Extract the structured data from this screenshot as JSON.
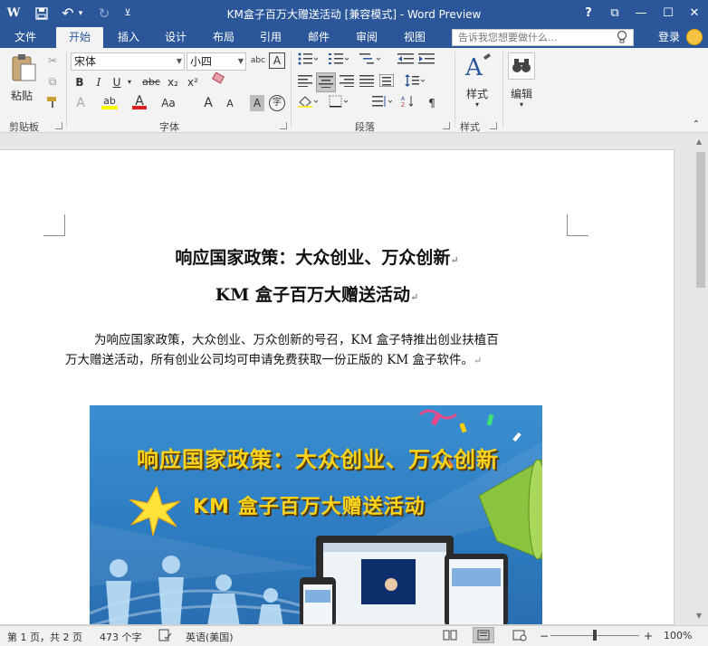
{
  "window": {
    "title": "KM盒子百万大赠送活动 [兼容模式] - Word Preview",
    "help": "?",
    "ribbon_display": "⧉",
    "minimize": "—",
    "maximize": "☐",
    "close": "✕"
  },
  "quick_access": {
    "app_logo": "W",
    "save": "💾",
    "undo": "↶",
    "undo_dd": "▾",
    "redo": "↻",
    "customize": "⊻"
  },
  "tabs": [
    {
      "label": "文件"
    },
    {
      "label": "开始"
    },
    {
      "label": "插入"
    },
    {
      "label": "设计"
    },
    {
      "label": "布局"
    },
    {
      "label": "引用"
    },
    {
      "label": "邮件"
    },
    {
      "label": "审阅"
    },
    {
      "label": "视图"
    }
  ],
  "tell_me": {
    "placeholder": "告诉我您想要做什么..."
  },
  "account": {
    "login": "登录"
  },
  "ribbon": {
    "clipboard": {
      "label": "剪贴板",
      "paste": "粘贴"
    },
    "font": {
      "label": "字体",
      "font_name": "宋体",
      "font_size": "小四",
      "bold": "B",
      "italic": "I",
      "underline": "U",
      "strike": "abc",
      "subscript": "x₂",
      "superscript": "x²",
      "effects": "A",
      "highlight": "ab",
      "font_color": "A",
      "case": "Aa",
      "grow": "A",
      "shrink": "A",
      "char_shading": "A",
      "enclose": "字",
      "phonetic": "abc",
      "char_border": "A"
    },
    "paragraph": {
      "label": "段落"
    },
    "styles": {
      "label": "样式",
      "styles_button": "样式"
    },
    "editing": {
      "editing_button": "编辑"
    }
  },
  "document": {
    "heading1": "响应国家政策：大众创业、万众创新",
    "heading2": "KM 盒子百万大赠送活动",
    "para_line1": "为响应国家政策，大众创业、万众创新的号召，KM 盒子特推出创业扶植百",
    "para_line2": "万大赠送活动，所有创业公司均可申请免费获取一份正版的 KM 盒子软件。",
    "mark": "↵",
    "banner_line1": "响应国家政策：大众创业、万众创新",
    "banner_line2": "KM 盒子百万大赠送活动"
  },
  "statusbar": {
    "page": "第 1 页，共 2 页",
    "words": "473 个字",
    "language": "英语(美国)",
    "zoom": "100%",
    "zoom_minus": "−",
    "zoom_plus": "+",
    "zoom_level": 0.5
  }
}
